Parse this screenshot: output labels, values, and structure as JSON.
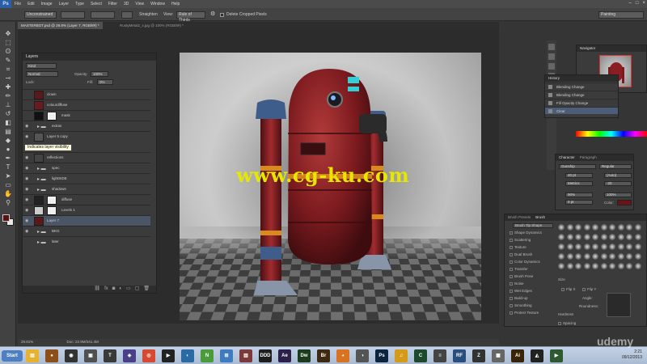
{
  "app": {
    "logo": "Ps",
    "menu": [
      "File",
      "Edit",
      "Image",
      "Layer",
      "Type",
      "Select",
      "Filter",
      "3D",
      "View",
      "Window",
      "Help"
    ],
    "window_controls": [
      "–",
      "□",
      "×"
    ]
  },
  "options_bar": {
    "ratio_value": "Unconstrained",
    "straighten_label": "Straighten",
    "view_label": "View:",
    "view_value": "Rule of Thirds",
    "delete_cropped_label": "Delete Cropped Pixels",
    "workspace": "Painting"
  },
  "document_tabs": [
    {
      "label": "MASTERBOT.psd @ 29.8% (Layer 7, RGB/8#) *",
      "active": true
    },
    {
      "label": "RustyMetal2_s.jpg @ 100% (RGB/8#) *",
      "active": false
    }
  ],
  "layers_panel": {
    "title": "Layers",
    "kind_label": "Kind",
    "blend_mode": "Normal",
    "opacity_label": "Opacity:",
    "opacity_value": "100%",
    "lock_label": "Lock:",
    "fill_label": "Fill:",
    "fill_value": "0%",
    "layers": [
      {
        "name": "clown",
        "type": "layer",
        "thumb": "#5a1a1a",
        "mask": false,
        "eye": false
      },
      {
        "name": "colourdiffuse",
        "type": "layer",
        "thumb": "#6a1c1c",
        "mask": false,
        "eye": false
      },
      {
        "name": "mask",
        "type": "layer",
        "thumb": "#111111",
        "mask": true,
        "eye": false
      },
      {
        "name": "extras",
        "type": "group",
        "eye": true
      },
      {
        "name": "Layer 5 copy",
        "type": "layer",
        "thumb": "#555555",
        "mask": false,
        "eye": true
      },
      {
        "name": "Indicates layer visibility",
        "type": "tooltip"
      },
      {
        "name": "reflections",
        "type": "layer",
        "thumb": "#444444",
        "mask": false,
        "eye": true
      },
      {
        "name": "spec",
        "type": "group",
        "eye": true
      },
      {
        "name": "lightSIDE",
        "type": "group",
        "eye": true
      },
      {
        "name": "shadows",
        "type": "group",
        "eye": true
      },
      {
        "name": "diffuse",
        "type": "layer",
        "thumb": "#222222",
        "mask": true,
        "eye": true
      },
      {
        "name": "Levels 1",
        "type": "adjustment",
        "thumb": "#cccccc",
        "mask": true,
        "eye": true
      },
      {
        "name": "Layer 7",
        "type": "layer",
        "thumb": "#5a1a1a",
        "mask": false,
        "eye": true,
        "selected": true
      },
      {
        "name": "BKG",
        "type": "group",
        "eye": true
      },
      {
        "name": "later",
        "type": "group",
        "eye": false
      }
    ]
  },
  "watermark": "www.cg-ku.com",
  "navigator": {
    "title": "Navigator"
  },
  "history": {
    "title": "History",
    "items": [
      "Blending Change",
      "Blending Change",
      "Fill Opacity Change",
      "Clear"
    ],
    "selected_index": 3
  },
  "character": {
    "tabs": [
      "Character",
      "Paragraph"
    ],
    "font": "Gunship",
    "style": "Regular",
    "size": "40 pt",
    "leading": "(Auto)",
    "kerning": "Metrics",
    "tracking": "-20",
    "v_scale": "90%",
    "h_scale": "100%",
    "baseline": "0 pt",
    "color_label": "Color:"
  },
  "brush_panel": {
    "tabs": [
      "Brush Presets",
      "Brush"
    ],
    "tip_shape_label": "Brush Tip Shape",
    "options": [
      "Shape Dynamics",
      "Scattering",
      "Texture",
      "Dual Brush",
      "Color Dynamics",
      "Transfer",
      "Brush Pose",
      "Noise",
      "Wet Edges",
      "Build-up",
      "Smoothing",
      "Protect Texture"
    ],
    "size_label": "Size",
    "flip_x": "Flip X",
    "flip_y": "Flip Y",
    "angle_label": "Angle:",
    "roundness_label": "Roundness:",
    "hardness_label": "Hardness",
    "spacing_label": "Spacing"
  },
  "status_bar": {
    "zoom": "29.81%",
    "doc_info": "Doc: 22.9M/341.4M"
  },
  "taskbar": {
    "start_label": "Start",
    "time": "2:21",
    "date": "09/12/2013",
    "apps": [
      {
        "name": "explorer",
        "color": "#e8b230",
        "glyph": "▤"
      },
      {
        "name": "media",
        "color": "#8c4f1a",
        "glyph": "●"
      },
      {
        "name": "recorder",
        "color": "#333333",
        "glyph": "◉"
      },
      {
        "name": "tool",
        "color": "#505050",
        "glyph": "▣"
      },
      {
        "name": "app5",
        "color": "#3a3a3a",
        "glyph": "T"
      },
      {
        "name": "app6",
        "color": "#4b3f8a",
        "glyph": "◈"
      },
      {
        "name": "chrome",
        "color": "#d64b2f",
        "glyph": "◎"
      },
      {
        "name": "app8",
        "color": "#222222",
        "glyph": "▶"
      },
      {
        "name": "app9",
        "color": "#2a6aa5",
        "glyph": "◐"
      },
      {
        "name": "notepad",
        "color": "#4a9b3a",
        "glyph": "N"
      },
      {
        "name": "app11",
        "color": "#3e7bbf",
        "glyph": "⊞"
      },
      {
        "name": "app12",
        "color": "#7d3a3a",
        "glyph": "▥"
      },
      {
        "name": "3dsmax",
        "color": "#1e1e1e",
        "glyph": "DDD"
      },
      {
        "name": "after-effects",
        "color": "#2c1f4a",
        "glyph": "Ae"
      },
      {
        "name": "dreamweaver",
        "color": "#1d3b1d",
        "glyph": "Dw"
      },
      {
        "name": "bridge",
        "color": "#3d2a10",
        "glyph": "Br"
      },
      {
        "name": "firefox",
        "color": "#d9731f",
        "glyph": "◕"
      },
      {
        "name": "app18",
        "color": "#555555",
        "glyph": "◑"
      },
      {
        "name": "photoshop",
        "color": "#0b2440",
        "glyph": "Ps"
      },
      {
        "name": "audition",
        "color": "#d59b18",
        "glyph": "♫"
      },
      {
        "name": "app21",
        "color": "#1d4a2a",
        "glyph": "C"
      },
      {
        "name": "app22",
        "color": "#444444",
        "glyph": "≡"
      },
      {
        "name": "app23",
        "color": "#2a4e7d",
        "glyph": "RF"
      },
      {
        "name": "zbrush",
        "color": "#333333",
        "glyph": "Z"
      },
      {
        "name": "app25",
        "color": "#666666",
        "glyph": "▩"
      },
      {
        "name": "illustrator",
        "color": "#3a2408",
        "glyph": "Ai"
      },
      {
        "name": "unity",
        "color": "#222222",
        "glyph": "◭"
      },
      {
        "name": "app28",
        "color": "#2f5a2f",
        "glyph": "▶"
      }
    ]
  },
  "overlay_brand": "udemy"
}
